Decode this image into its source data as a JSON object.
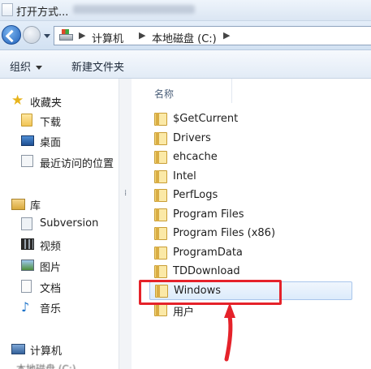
{
  "window": {
    "title": "打开方式..."
  },
  "address_bar": {
    "crumbs": [
      "计算机",
      "本地磁盘 (C:)"
    ]
  },
  "toolbar": {
    "organize_label": "组织",
    "new_folder_label": "新建文件夹"
  },
  "nav_pane": {
    "favorites": {
      "label": "收藏夹",
      "items": [
        "下载",
        "桌面",
        "最近访问的位置"
      ]
    },
    "libraries": {
      "label": "库",
      "items": [
        "Subversion",
        "视频",
        "图片",
        "文档",
        "音乐"
      ]
    },
    "computer": {
      "label": "计算机",
      "partial_item": "本地磁盘 (C:)"
    }
  },
  "content": {
    "column_header": "名称",
    "files": [
      "$GetCurrent",
      "Drivers",
      "ehcache",
      "Intel",
      "PerfLogs",
      "Program Files",
      "Program Files (x86)",
      "ProgramData",
      "TDDownload",
      "Windows",
      "用户"
    ],
    "selected_index": 9
  },
  "colors": {
    "highlight": "#e5222a",
    "selection_bg": "#dcebfb"
  }
}
